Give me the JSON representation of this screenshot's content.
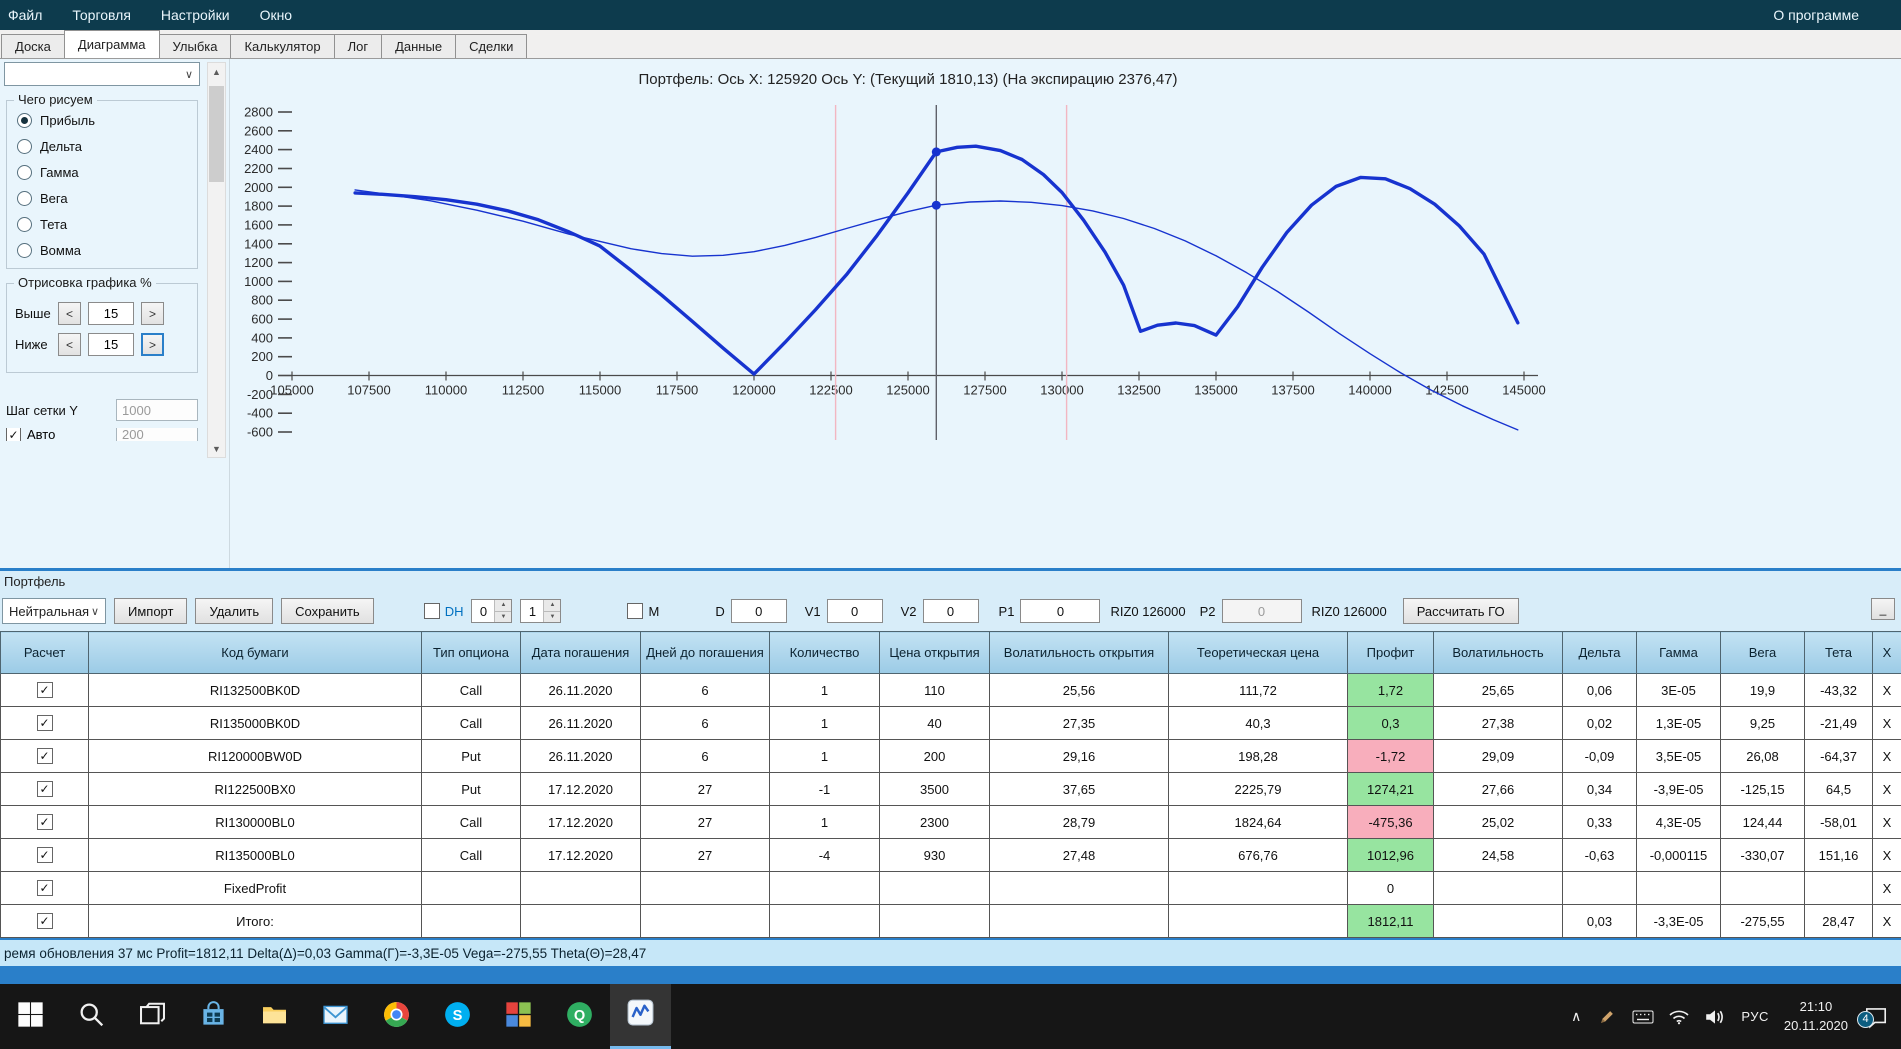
{
  "colors": {
    "menu_bg": "#0d3b4d",
    "panel_bg": "#e9f5fc",
    "section_bg": "#d8edf9",
    "accent_blue": "#2a7fc9",
    "header_blue_top": "#c3e2f3",
    "header_blue_bottom": "#9bcbe6",
    "status_bg": "#c6e7f8",
    "profit_green": "#97e4a0",
    "loss_pink": "#f8aebc",
    "link_blue": "#0070c0"
  },
  "icons": {
    "chevron_down": "∨",
    "chevron_up": "∧",
    "spin_up": "▲",
    "spin_down": "▼",
    "scroll_up": "▲",
    "scroll_down": "▼",
    "arrow_left": "<",
    "arrow_right": ">",
    "check": "✓",
    "minimize": "_"
  },
  "menubar": {
    "items": [
      "Файл",
      "Торговля",
      "Настройки",
      "Окно"
    ],
    "right_item": "О программе"
  },
  "tabs": {
    "items": [
      "Доска",
      "Диаграмма",
      "Улыбка",
      "Калькулятор",
      "Лог",
      "Данные",
      "Сделки"
    ],
    "active": "Диаграмма"
  },
  "sidebar": {
    "dropdown_value": "",
    "draw_group": {
      "title": "Чего рисуем",
      "options": [
        "Прибыль",
        "Дельта",
        "Гамма",
        "Вега",
        "Тета",
        "Вомма"
      ],
      "selected": "Прибыль"
    },
    "range_group": {
      "title": "Отрисовка графика %",
      "rows": [
        {
          "label": "Выше",
          "value": "15"
        },
        {
          "label": "Ниже",
          "value": "15"
        }
      ]
    },
    "grid_step": {
      "label": "Шаг сетки Y",
      "value": "1000"
    },
    "auto_row": {
      "label": "Авто",
      "value": "200",
      "checked": true
    }
  },
  "chart_data": {
    "type": "line",
    "title": "Портфель: Ось X: 125920 Ось Y:  (Текущий 1810,13)  (На экспирацию 2376,47)",
    "x_current": 125920,
    "y_current_label": "1810,13",
    "y_expiration_label": "2376,47",
    "x_range": [
      105000,
      145000
    ],
    "x_tick_step": 2500,
    "y_range": [
      -600,
      2800
    ],
    "y_tick_step": 200,
    "grid": false,
    "legend": "none",
    "line_color": "#1733cf",
    "series": [
      {
        "name": "На экспирацию",
        "stroke_width": 3.4,
        "points": [
          [
            107050,
            1940
          ],
          [
            108000,
            1925
          ],
          [
            109000,
            1900
          ],
          [
            110000,
            1868
          ],
          [
            111000,
            1820
          ],
          [
            112000,
            1750
          ],
          [
            113000,
            1655
          ],
          [
            114000,
            1525
          ],
          [
            115000,
            1375
          ],
          [
            116000,
            1120
          ],
          [
            117000,
            855
          ],
          [
            118000,
            575
          ],
          [
            119000,
            290
          ],
          [
            120000,
            15
          ],
          [
            121000,
            350
          ],
          [
            122000,
            700
          ],
          [
            123000,
            1070
          ],
          [
            124000,
            1490
          ],
          [
            125000,
            1940
          ],
          [
            125920,
            2376
          ],
          [
            126600,
            2425
          ],
          [
            127200,
            2437
          ],
          [
            128000,
            2390
          ],
          [
            128700,
            2295
          ],
          [
            129400,
            2135
          ],
          [
            130000,
            1945
          ],
          [
            130700,
            1650
          ],
          [
            131400,
            1310
          ],
          [
            132000,
            960
          ],
          [
            132550,
            470
          ],
          [
            133100,
            535
          ],
          [
            133700,
            558
          ],
          [
            134300,
            530
          ],
          [
            135000,
            430
          ],
          [
            135700,
            730
          ],
          [
            136500,
            1150
          ],
          [
            137300,
            1520
          ],
          [
            138100,
            1810
          ],
          [
            138900,
            2010
          ],
          [
            139700,
            2105
          ],
          [
            140500,
            2090
          ],
          [
            141300,
            1985
          ],
          [
            142100,
            1820
          ],
          [
            142900,
            1590
          ],
          [
            143700,
            1290
          ],
          [
            144800,
            560
          ]
        ]
      },
      {
        "name": "Текущий",
        "stroke_width": 1.4,
        "points": [
          [
            107050,
            1972
          ],
          [
            108000,
            1930
          ],
          [
            109500,
            1857
          ],
          [
            111000,
            1757
          ],
          [
            112500,
            1640
          ],
          [
            114000,
            1502
          ],
          [
            115000,
            1425
          ],
          [
            116000,
            1348
          ],
          [
            117000,
            1295
          ],
          [
            118000,
            1268
          ],
          [
            119000,
            1277
          ],
          [
            120000,
            1316
          ],
          [
            121000,
            1383
          ],
          [
            122000,
            1468
          ],
          [
            123000,
            1562
          ],
          [
            124000,
            1655
          ],
          [
            125000,
            1742
          ],
          [
            125920,
            1810
          ],
          [
            127000,
            1844
          ],
          [
            128000,
            1854
          ],
          [
            129000,
            1841
          ],
          [
            130000,
            1806
          ],
          [
            131000,
            1749
          ],
          [
            132000,
            1668
          ],
          [
            133000,
            1562
          ],
          [
            134000,
            1430
          ],
          [
            135000,
            1272
          ],
          [
            136000,
            1092
          ],
          [
            137000,
            893
          ],
          [
            138000,
            675
          ],
          [
            139000,
            448
          ],
          [
            140000,
            232
          ],
          [
            141000,
            28
          ],
          [
            142000,
            -158
          ],
          [
            143000,
            -322
          ],
          [
            144000,
            -468
          ],
          [
            144800,
            -578
          ]
        ]
      }
    ],
    "vlines": [
      {
        "x": 122650,
        "color": "#f2b6c1"
      },
      {
        "x": 130150,
        "color": "#f2b6c1"
      },
      {
        "x": 125920,
        "color": "#5f6169"
      }
    ],
    "markers": [
      {
        "x": 125920,
        "y": 2376.47
      },
      {
        "x": 125920,
        "y": 1810.13
      }
    ]
  },
  "portfolio": {
    "section_label": "Портфель",
    "toolbar": {
      "strategy_value": "Нейтральная",
      "import_label": "Импорт",
      "delete_label": "Удалить",
      "save_label": "Сохранить",
      "dh_label": "DH",
      "dh_checked": false,
      "spin1": "0",
      "spin2": "1",
      "m_label": "M",
      "m_checked": false,
      "d_label": "D",
      "d_value": "0",
      "v1_label": "V1",
      "v1_value": "0",
      "v2_label": "V2",
      "v2_value": "0",
      "p1_label": "P1",
      "p1_value": "0",
      "p1_suffix": "RIZ0 126000",
      "p2_label": "P2",
      "p2_value": "0",
      "p2_suffix": "RIZ0 126000",
      "calc_button": "Рассчитать ГО"
    },
    "table": {
      "columns": [
        "Расчет",
        "Код бумаги",
        "Тип опциона",
        "Дата погашения",
        "Дней до погашения",
        "Количество",
        "Цена открытия",
        "Волатильность открытия",
        "Теоретическая цена",
        "Профит",
        "Волатильность",
        "Дельта",
        "Гамма",
        "Вега",
        "Тета",
        "X"
      ],
      "delete_label": "X",
      "rows": [
        {
          "checked": true,
          "code": "RI132500BK0D",
          "type": "Call",
          "date": "26.11.2020",
          "days": "6",
          "qty": "1",
          "price": "110",
          "vol_open": "25,56",
          "theo": "111,72",
          "profit": "1,72",
          "profit_state": "pos",
          "vol": "25,65",
          "delta": "0,06",
          "gamma": "3E-05",
          "vega": "19,9",
          "theta": "-43,32"
        },
        {
          "checked": true,
          "code": "RI135000BK0D",
          "type": "Call",
          "date": "26.11.2020",
          "days": "6",
          "qty": "1",
          "price": "40",
          "vol_open": "27,35",
          "theo": "40,3",
          "profit": "0,3",
          "profit_state": "pos",
          "vol": "27,38",
          "delta": "0,02",
          "gamma": "1,3E-05",
          "vega": "9,25",
          "theta": "-21,49"
        },
        {
          "checked": true,
          "code": "RI120000BW0D",
          "type": "Put",
          "date": "26.11.2020",
          "days": "6",
          "qty": "1",
          "price": "200",
          "vol_open": "29,16",
          "theo": "198,28",
          "profit": "-1,72",
          "profit_state": "neg",
          "vol": "29,09",
          "delta": "-0,09",
          "gamma": "3,5E-05",
          "vega": "26,08",
          "theta": "-64,37"
        },
        {
          "checked": true,
          "code": "RI122500BX0",
          "type": "Put",
          "date": "17.12.2020",
          "days": "27",
          "qty": "-1",
          "price": "3500",
          "vol_open": "37,65",
          "theo": "2225,79",
          "profit": "1274,21",
          "profit_state": "pos",
          "vol": "27,66",
          "delta": "0,34",
          "gamma": "-3,9E-05",
          "vega": "-125,15",
          "theta": "64,5"
        },
        {
          "checked": true,
          "code": "RI130000BL0",
          "type": "Call",
          "date": "17.12.2020",
          "days": "27",
          "qty": "1",
          "price": "2300",
          "vol_open": "28,79",
          "theo": "1824,64",
          "profit": "-475,36",
          "profit_state": "neg",
          "vol": "25,02",
          "delta": "0,33",
          "gamma": "4,3E-05",
          "vega": "124,44",
          "theta": "-58,01"
        },
        {
          "checked": true,
          "code": "RI135000BL0",
          "type": "Call",
          "date": "17.12.2020",
          "days": "27",
          "qty": "-4",
          "price": "930",
          "vol_open": "27,48",
          "theo": "676,76",
          "profit": "1012,96",
          "profit_state": "pos",
          "vol": "24,58",
          "delta": "-0,63",
          "gamma": "-0,000115",
          "vega": "-330,07",
          "theta": "151,16"
        },
        {
          "checked": true,
          "code": "FixedProfit",
          "type": "",
          "date": "",
          "days": "",
          "qty": "",
          "price": "",
          "vol_open": "",
          "theo": "",
          "profit": "0",
          "profit_state": "none",
          "vol": "",
          "delta": "",
          "gamma": "",
          "vega": "",
          "theta": ""
        },
        {
          "checked": true,
          "code": "Итого:",
          "type": "",
          "date": "",
          "days": "",
          "qty": "",
          "price": "",
          "vol_open": "",
          "theo": "",
          "profit": "1812,11",
          "profit_state": "pos",
          "vol": "",
          "delta": "0,03",
          "gamma": "-3,3E-05",
          "vega": "-275,55",
          "theta": "28,47"
        }
      ]
    }
  },
  "statusbar": {
    "text": "ремя обновления 37 мс   Profit=1812,11 Delta(Δ)=0,03 Gamma(Γ)=-3,3E-05 Vega=-275,55 Theta(Θ)=28,47"
  },
  "taskbar": {
    "app_icons": [
      "start",
      "search",
      "task-view",
      "store",
      "explorer",
      "mail",
      "chrome",
      "skype",
      "grid-app",
      "quik-app",
      "chart-app"
    ],
    "active_app": "chart-app",
    "tray_icons": [
      "pen",
      "keyboard",
      "wifi",
      "speaker"
    ],
    "tray": {
      "lang": "РУС",
      "time": "21:10",
      "date": "20.11.2020",
      "badge": "4"
    }
  }
}
